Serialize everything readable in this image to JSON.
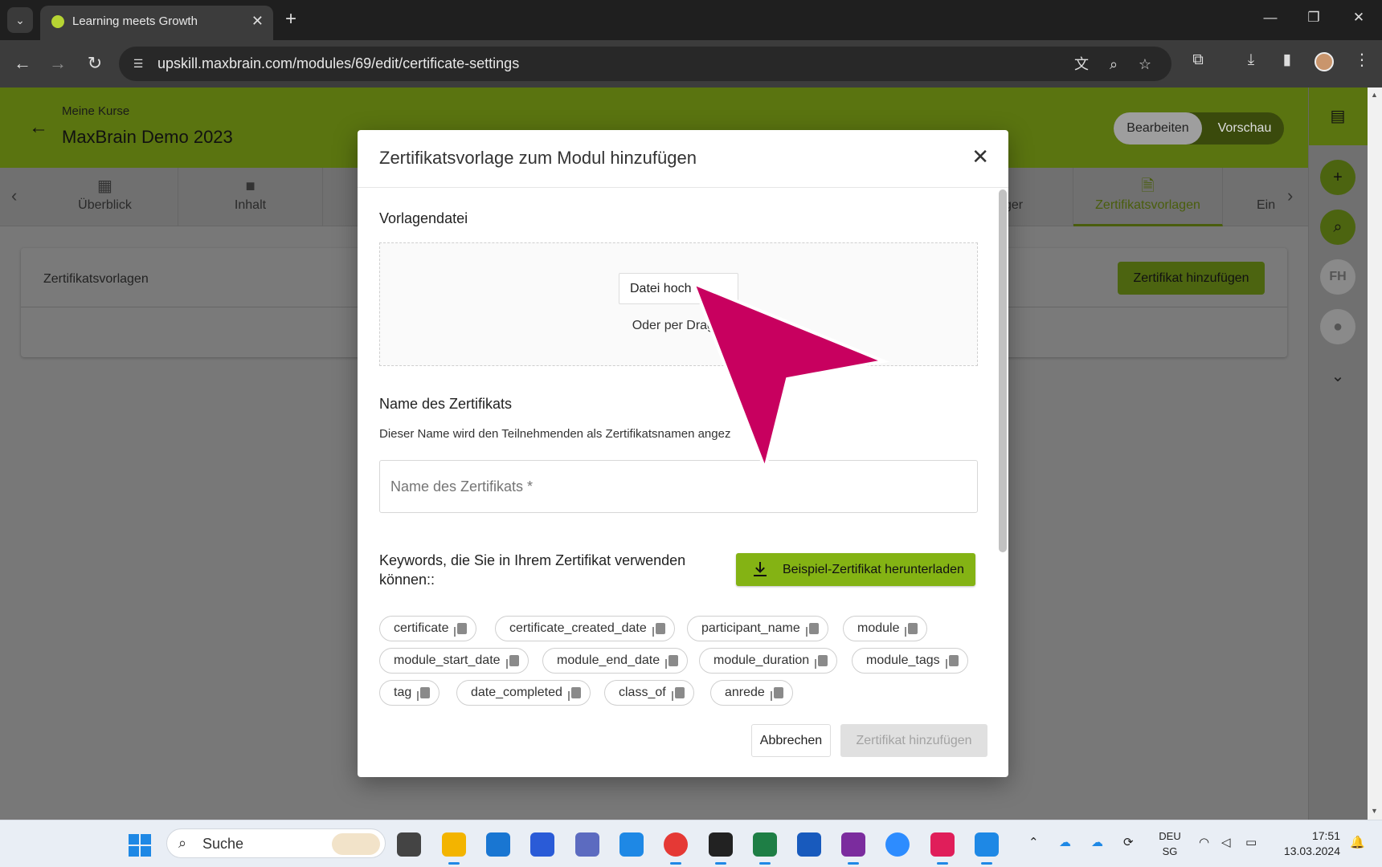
{
  "browser": {
    "tab_title": "Learning meets Growth",
    "url": "upskill.maxbrain.com/modules/69/edit/certificate-settings"
  },
  "header": {
    "breadcrumb": "Meine Kurse",
    "title": "MaxBrain Demo 2023",
    "mode_edit": "Bearbeiten",
    "mode_preview": "Vorschau"
  },
  "module_tabs": [
    {
      "label": "Überblick",
      "icon": "dashboard-icon"
    },
    {
      "label": "Inhalt",
      "icon": "folder-icon"
    },
    {
      "label": "ger",
      "icon": "list-icon"
    },
    {
      "label": "Zertifikatsvorlagen",
      "icon": "certificate-icon"
    },
    {
      "label": "Ein",
      "icon": "settings-icon"
    }
  ],
  "card": {
    "title": "Zertifikatsvorlagen",
    "add_button": "Zertifikat hinzufügen"
  },
  "modal": {
    "title": "Zertifikatsvorlage zum Modul hinzufügen",
    "template_label": "Vorlagendatei",
    "upload_button": "Datei hoch",
    "drag_hint": "Oder per Drag a",
    "name_label": "Name des Zertifikats",
    "name_helper": "Dieser Name wird den Teilnehmenden als Zertifikatsnamen angez",
    "name_placeholder": "Name des Zertifikats *",
    "keywords_label": "Keywords, die Sie in Ihrem Zertifikat verwenden können::",
    "download_button": "Beispiel-Zertifikat herunterladen",
    "keywords": [
      "certificate",
      "certificate_created_date",
      "participant_name",
      "module",
      "module_start_date",
      "module_end_date",
      "module_duration",
      "module_tags",
      "tag",
      "date_completed",
      "class_of",
      "anrede"
    ],
    "cancel_button": "Abbrechen",
    "submit_button": "Zertifikat hinzufügen"
  },
  "rail": {
    "avatar_initials": "FH"
  },
  "taskbar": {
    "search_label": "Suche",
    "lang_line1": "DEU",
    "lang_line2": "SG",
    "time": "17:51",
    "date": "13.03.2024"
  },
  "colors": {
    "brand_green": "#84b314",
    "pointer": "#c8005f"
  }
}
